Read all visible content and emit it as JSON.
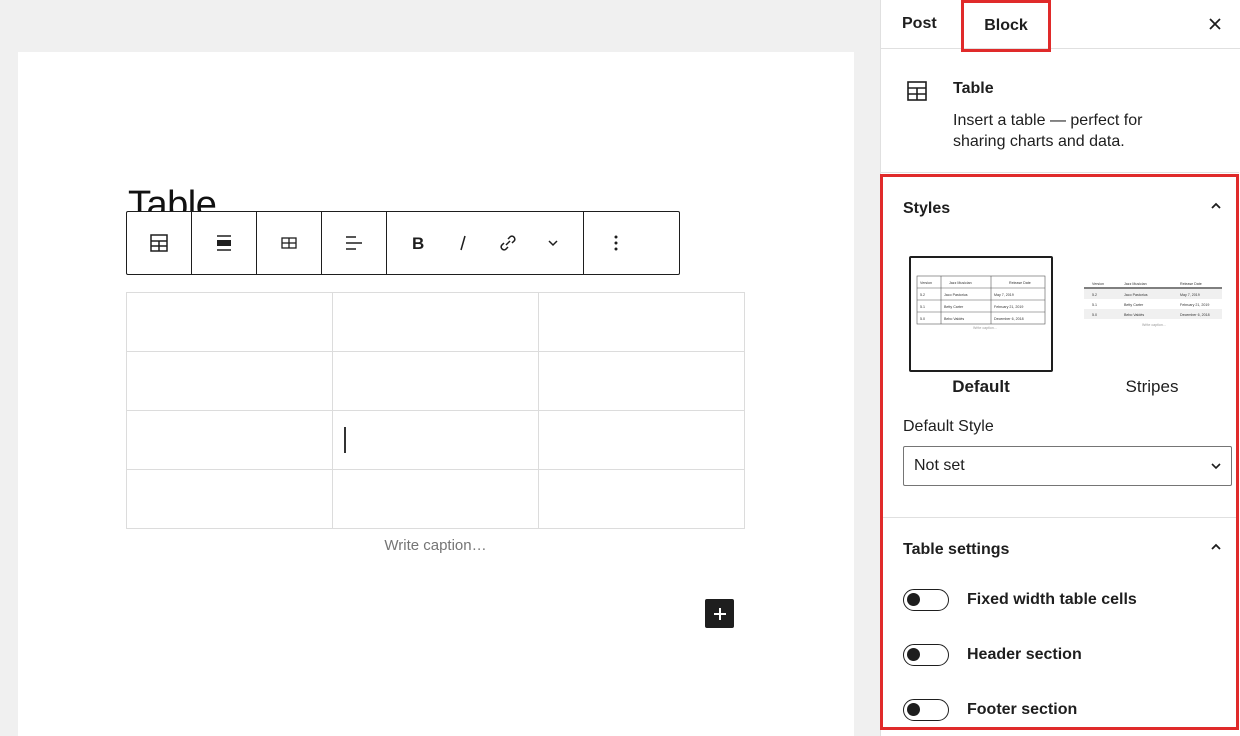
{
  "editor": {
    "title": "Table",
    "caption_placeholder": "Write caption…",
    "table": {
      "rows": 4,
      "cols": 3
    }
  },
  "toolbar": {
    "icons": [
      "table-icon",
      "align-icon",
      "edit-table-icon",
      "text-align-icon",
      "bold-icon",
      "italic-icon",
      "link-icon",
      "more-formatting-chevron-icon",
      "options-icon"
    ]
  },
  "sidebar": {
    "tabs": {
      "post": "Post",
      "block": "Block"
    },
    "block_card": {
      "name": "Table",
      "description": "Insert a table — perfect for sharing charts and data."
    },
    "styles": {
      "title": "Styles",
      "options": [
        {
          "label": "Default",
          "selected": true
        },
        {
          "label": "Stripes",
          "selected": false
        }
      ],
      "default_style_label": "Default Style",
      "default_style_value": "Not set",
      "preview": {
        "headers": [
          "Version",
          "Jazz Musician",
          "Release Date"
        ],
        "rows": [
          [
            "5.2",
            "Jaco Pastorius",
            "May 7, 2019"
          ],
          [
            "5.1",
            "Betty Carter",
            "February 21, 2019"
          ],
          [
            "5.0",
            "Bebo Valdés",
            "December 6, 2018"
          ]
        ],
        "caption": "Write caption…"
      }
    },
    "table_settings": {
      "title": "Table settings",
      "toggles": [
        {
          "label": "Fixed width table cells",
          "on": false
        },
        {
          "label": "Header section",
          "on": false
        },
        {
          "label": "Footer section",
          "on": false
        }
      ]
    }
  },
  "colors": {
    "highlight": "#e02a2a",
    "text": "#1e1e1e"
  }
}
